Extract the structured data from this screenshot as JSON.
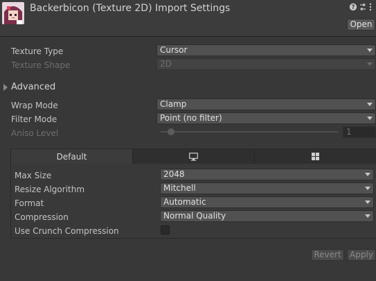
{
  "header": {
    "title": "Backerbicon (Texture 2D) Import Settings",
    "open_label": "Open",
    "icons": [
      "help-icon",
      "preset-icon",
      "more-icon"
    ]
  },
  "fields": {
    "texture_type": {
      "label": "Texture Type",
      "value": "Cursor"
    },
    "texture_shape": {
      "label": "Texture Shape",
      "value": "2D"
    },
    "advanced": {
      "label": "Advanced"
    },
    "wrap_mode": {
      "label": "Wrap Mode",
      "value": "Clamp"
    },
    "filter_mode": {
      "label": "Filter Mode",
      "value": "Point (no filter)"
    },
    "aniso_level": {
      "label": "Aniso Level",
      "value": "1"
    }
  },
  "platform": {
    "tabs": [
      {
        "label": "Default",
        "icon": ""
      },
      {
        "label": "",
        "icon": "monitor-icon"
      },
      {
        "label": "",
        "icon": "windows-icon"
      }
    ],
    "max_size": {
      "label": "Max Size",
      "value": "2048"
    },
    "resize_algorithm": {
      "label": "Resize Algorithm",
      "value": "Mitchell"
    },
    "format": {
      "label": "Format",
      "value": "Automatic"
    },
    "compression": {
      "label": "Compression",
      "value": "Normal Quality"
    },
    "crunch": {
      "label": "Use Crunch Compression",
      "checked": false
    }
  },
  "footer": {
    "revert_label": "Revert",
    "apply_label": "Apply"
  }
}
